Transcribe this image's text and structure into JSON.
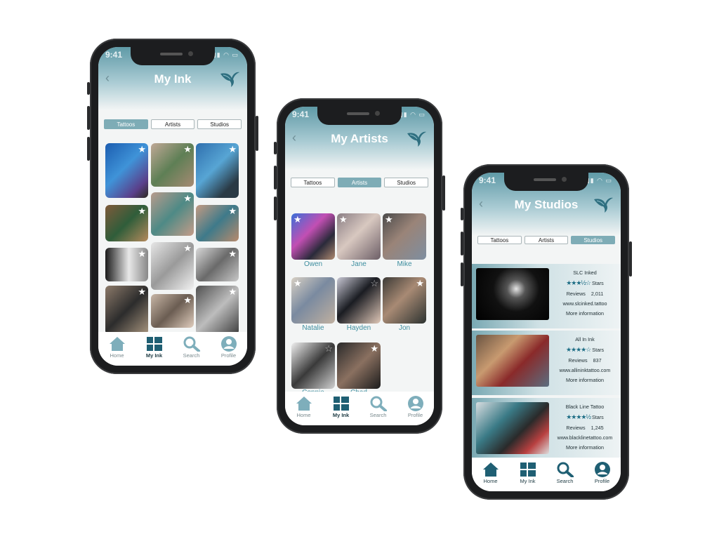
{
  "status_time": "9:41",
  "tabs": [
    "Tattoos",
    "Artists",
    "Studios"
  ],
  "nav": {
    "home": "Home",
    "myink": "My Ink",
    "search": "Search",
    "profile": "Profile"
  },
  "screens": {
    "my_ink": {
      "title": "My Ink",
      "active_tab": "Tattoos"
    },
    "my_artists": {
      "title": "My Artists",
      "active_tab": "Artists",
      "artists": [
        "Owen",
        "Jane",
        "Mike",
        "Natalie",
        "Hayden",
        "Jon",
        "Connie",
        "Chad"
      ]
    },
    "my_studios": {
      "title": "My Studios",
      "active_tab": "Studios",
      "studios": [
        {
          "name": "SLC Inked",
          "rating": "★★★½☆",
          "stars_label": "Stars",
          "reviews_label": "Reviews",
          "reviews": "2,011",
          "url": "www.slcinked.tattoo",
          "more": "More information"
        },
        {
          "name": "All In Ink",
          "rating": "★★★★☆",
          "stars_label": "Stars",
          "reviews_label": "Reviews",
          "reviews": "837",
          "url": "www.allininktattoo.com",
          "more": "More information"
        },
        {
          "name": "Black Line Tattoo",
          "rating": "★★★★½",
          "stars_label": "Stars",
          "reviews_label": "Reviews",
          "reviews": "1,245",
          "url": "www.blacklinetattoo.com",
          "more": "More information"
        }
      ]
    }
  },
  "colors": {
    "accent": "#7eacb6",
    "header": "#5f9aa7",
    "dark": "#1f5f73",
    "name_text": "#3f8fa0"
  }
}
